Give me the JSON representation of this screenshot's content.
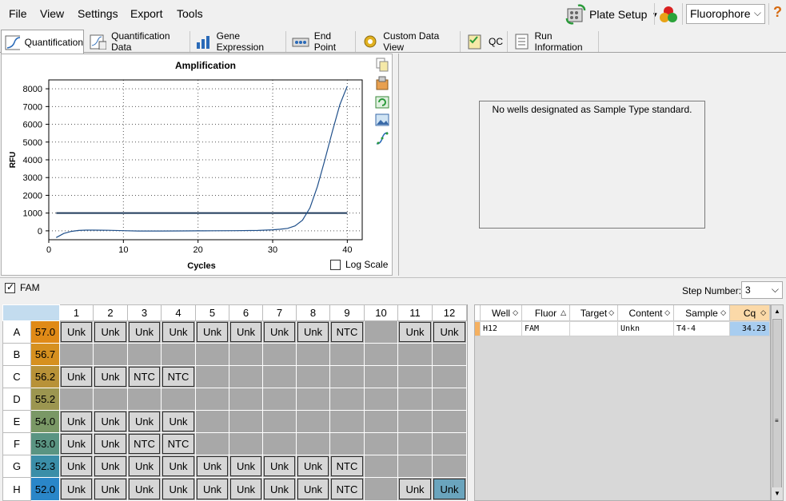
{
  "menu": [
    "File",
    "View",
    "Settings",
    "Export",
    "Tools"
  ],
  "toolbar": {
    "plate_setup": "Plate Setup",
    "fluor_select": "Fluorophore",
    "help": "?"
  },
  "tabs": [
    "Quantification",
    "Quantification Data",
    "Gene Expression",
    "End Point",
    "Custom Data View",
    "QC",
    "Run Information"
  ],
  "chart_data": {
    "type": "line",
    "title": "Amplification",
    "xlabel": "Cycles",
    "ylabel": "RFU",
    "xlim": [
      0,
      42
    ],
    "ylim": [
      -500,
      8500
    ],
    "xticks": [
      0,
      10,
      20,
      30,
      40
    ],
    "yticks": [
      0,
      1000,
      2000,
      3000,
      4000,
      5000,
      6000,
      7000,
      8000
    ],
    "grid": true,
    "threshold": 1000,
    "series": [
      {
        "x": [
          1,
          2,
          3,
          4,
          5,
          6,
          8,
          10,
          12,
          15,
          18,
          20,
          22,
          25,
          28,
          30,
          31,
          32,
          33,
          34,
          35,
          36,
          37,
          38,
          39,
          40
        ],
        "y": [
          -380,
          -150,
          -30,
          20,
          40,
          40,
          30,
          10,
          -10,
          -10,
          -5,
          0,
          5,
          10,
          20,
          60,
          90,
          140,
          280,
          600,
          1300,
          2500,
          4000,
          5600,
          7100,
          8150
        ]
      }
    ]
  },
  "log_scale_label": "Log Scale",
  "standard_msg": "No wells designated as Sample Type standard.",
  "fam_label": "FAM",
  "step": {
    "label": "Step Number:",
    "value": "3"
  },
  "plate": {
    "columns": [
      "1",
      "2",
      "3",
      "4",
      "5",
      "6",
      "7",
      "8",
      "9",
      "10",
      "11",
      "12"
    ],
    "rows": [
      {
        "row": "A",
        "temp": "57.0",
        "color": "#e08a17",
        "wells": [
          "Unk",
          "Unk",
          "Unk",
          "Unk",
          "Unk",
          "Unk",
          "Unk",
          "Unk",
          "NTC",
          "",
          "Unk",
          "Unk"
        ]
      },
      {
        "row": "B",
        "temp": "56.7",
        "color": "#d6901f",
        "wells": [
          "",
          "",
          "",
          "",
          "",
          "",
          "",
          "",
          "",
          "",
          "",
          ""
        ]
      },
      {
        "row": "C",
        "temp": "56.2",
        "color": "#b89238",
        "wells": [
          "Unk",
          "Unk",
          "NTC",
          "NTC",
          "",
          "",
          "",
          "",
          "",
          "",
          "",
          ""
        ]
      },
      {
        "row": "D",
        "temp": "55.2",
        "color": "#9c9650",
        "wells": [
          "",
          "",
          "",
          "",
          "",
          "",
          "",
          "",
          "",
          "",
          "",
          ""
        ]
      },
      {
        "row": "E",
        "temp": "54.0",
        "color": "#7a9866",
        "wells": [
          "Unk",
          "Unk",
          "Unk",
          "Unk",
          "",
          "",
          "",
          "",
          "",
          "",
          "",
          ""
        ]
      },
      {
        "row": "F",
        "temp": "53.0",
        "color": "#5a9482",
        "wells": [
          "Unk",
          "Unk",
          "NTC",
          "NTC",
          "",
          "",
          "",
          "",
          "",
          "",
          "",
          ""
        ]
      },
      {
        "row": "G",
        "temp": "52.3",
        "color": "#3b8ea8",
        "wells": [
          "Unk",
          "Unk",
          "Unk",
          "Unk",
          "Unk",
          "Unk",
          "Unk",
          "Unk",
          "NTC",
          "",
          "",
          ""
        ]
      },
      {
        "row": "H",
        "temp": "52.0",
        "color": "#2a86c8",
        "wells": [
          "Unk",
          "Unk",
          "Unk",
          "Unk",
          "Unk",
          "Unk",
          "Unk",
          "Unk",
          "NTC",
          "",
          "Unk",
          "Unk"
        ]
      }
    ],
    "selected": "H12"
  },
  "results": {
    "headers": [
      "Well",
      "Fluor",
      "Target",
      "Content",
      "Sample",
      "Cq"
    ],
    "row": {
      "well": "H12",
      "fluor": "FAM",
      "target": "",
      "content": "Unkn",
      "sample": "T4-4",
      "cq": "34.23"
    }
  }
}
